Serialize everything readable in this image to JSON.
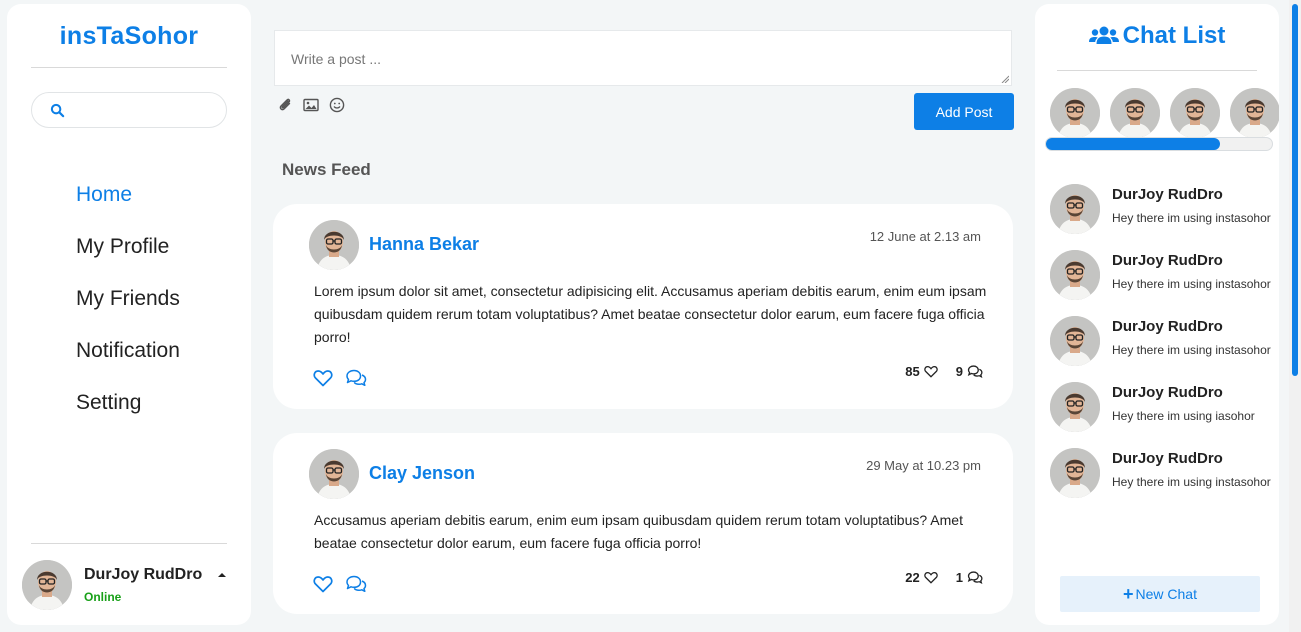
{
  "app": {
    "logo_text": "nsTaSohor",
    "logo_glyph": "i",
    "brand_color": "#0d7fe6"
  },
  "sidebar": {
    "search": {
      "placeholder": "",
      "value": ""
    },
    "nav": [
      {
        "label": "Home",
        "active": true
      },
      {
        "label": "My Profile"
      },
      {
        "label": "My Friends"
      },
      {
        "label": "Notification"
      },
      {
        "label": "Setting"
      }
    ],
    "user": {
      "name": "DurJoy RudDro",
      "status": "Online",
      "status_color": "#18a018"
    }
  },
  "composer": {
    "placeholder": "Write a post ...",
    "add_post_label": "Add Post",
    "tools": [
      "paperclip-icon",
      "image-icon",
      "smile-icon"
    ]
  },
  "feed": {
    "title": "News Feed",
    "posts": [
      {
        "author": "Hanna Bekar",
        "time": "12 June at 2.13 am",
        "body": "Lorem ipsum dolor sit amet, consectetur adipisicing elit. Accusamus aperiam debitis earum, enim eum ipsam quibusdam quidem rerum totam voluptatibus? Amet beatae consectetur dolor earum, eum facere fuga officia porro!",
        "likes": "85",
        "comments": "9"
      },
      {
        "author": "Clay Jenson",
        "time": "29 May at 10.23 pm",
        "body": "Accusamus aperiam debitis earum, enim eum ipsam quibusdam quidem rerum totam voluptatibus? Amet beatae consectetur dolor earum, eum facere fuga officia porro!",
        "likes": "22",
        "comments": "1"
      }
    ]
  },
  "chat": {
    "title": "Chat List",
    "stories_scroll_fraction": 0.77,
    "items": [
      {
        "name": "DurJoy RudDro",
        "message": "Hey there im using instasohor"
      },
      {
        "name": "DurJoy RudDro",
        "message": "Hey there im using instasohor"
      },
      {
        "name": "DurJoy RudDro",
        "message": "Hey there im using instasohor"
      },
      {
        "name": "DurJoy RudDro",
        "message": "Hey there im using iasohor"
      },
      {
        "name": "DurJoy RudDro",
        "message": "Hey there im using instasohor"
      }
    ],
    "new_chat_label": "New Chat"
  }
}
